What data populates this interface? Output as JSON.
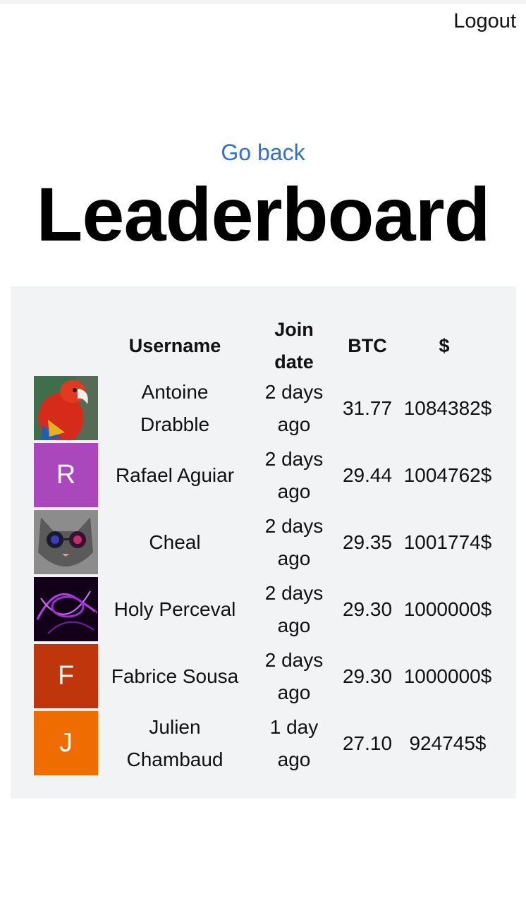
{
  "header": {
    "logout_label": "Logout"
  },
  "nav": {
    "go_back_label": "Go back"
  },
  "page": {
    "title": "Leaderboard"
  },
  "table": {
    "columns": [
      "",
      "Username",
      "Join date",
      "BTC",
      "$"
    ],
    "rows": [
      {
        "avatar": "parrot-photo",
        "avatar_letter": "",
        "username": "Antoine Drabble",
        "join_date": "2 days ago",
        "btc": "31.77",
        "usd": "1084382$"
      },
      {
        "avatar": "letter",
        "avatar_letter": "R",
        "avatar_color": "#ab47bc",
        "username": "Rafael Aguiar",
        "join_date": "2 days ago",
        "btc": "29.44",
        "usd": "1004762$"
      },
      {
        "avatar": "cat-sunglasses-photo",
        "avatar_letter": "",
        "username": "Cheal",
        "join_date": "2 days ago",
        "btc": "29.35",
        "usd": "1001774$"
      },
      {
        "avatar": "purple-abstract-photo",
        "avatar_letter": "",
        "username": "Holy Perceval",
        "join_date": "2 days ago",
        "btc": "29.30",
        "usd": "1000000$"
      },
      {
        "avatar": "letter",
        "avatar_letter": "F",
        "avatar_color": "#bf360c",
        "username": "Fabrice Sousa",
        "join_date": "2 days ago",
        "btc": "29.30",
        "usd": "1000000$"
      },
      {
        "avatar": "letter",
        "avatar_letter": "J",
        "avatar_color": "#ef6c00",
        "username": "Julien Chambaud",
        "join_date": "1 day ago",
        "btc": "27.10",
        "usd": "924745$"
      }
    ]
  },
  "colors": {
    "link": "#2f6fd6",
    "table_bg": "#f1f3f4"
  }
}
